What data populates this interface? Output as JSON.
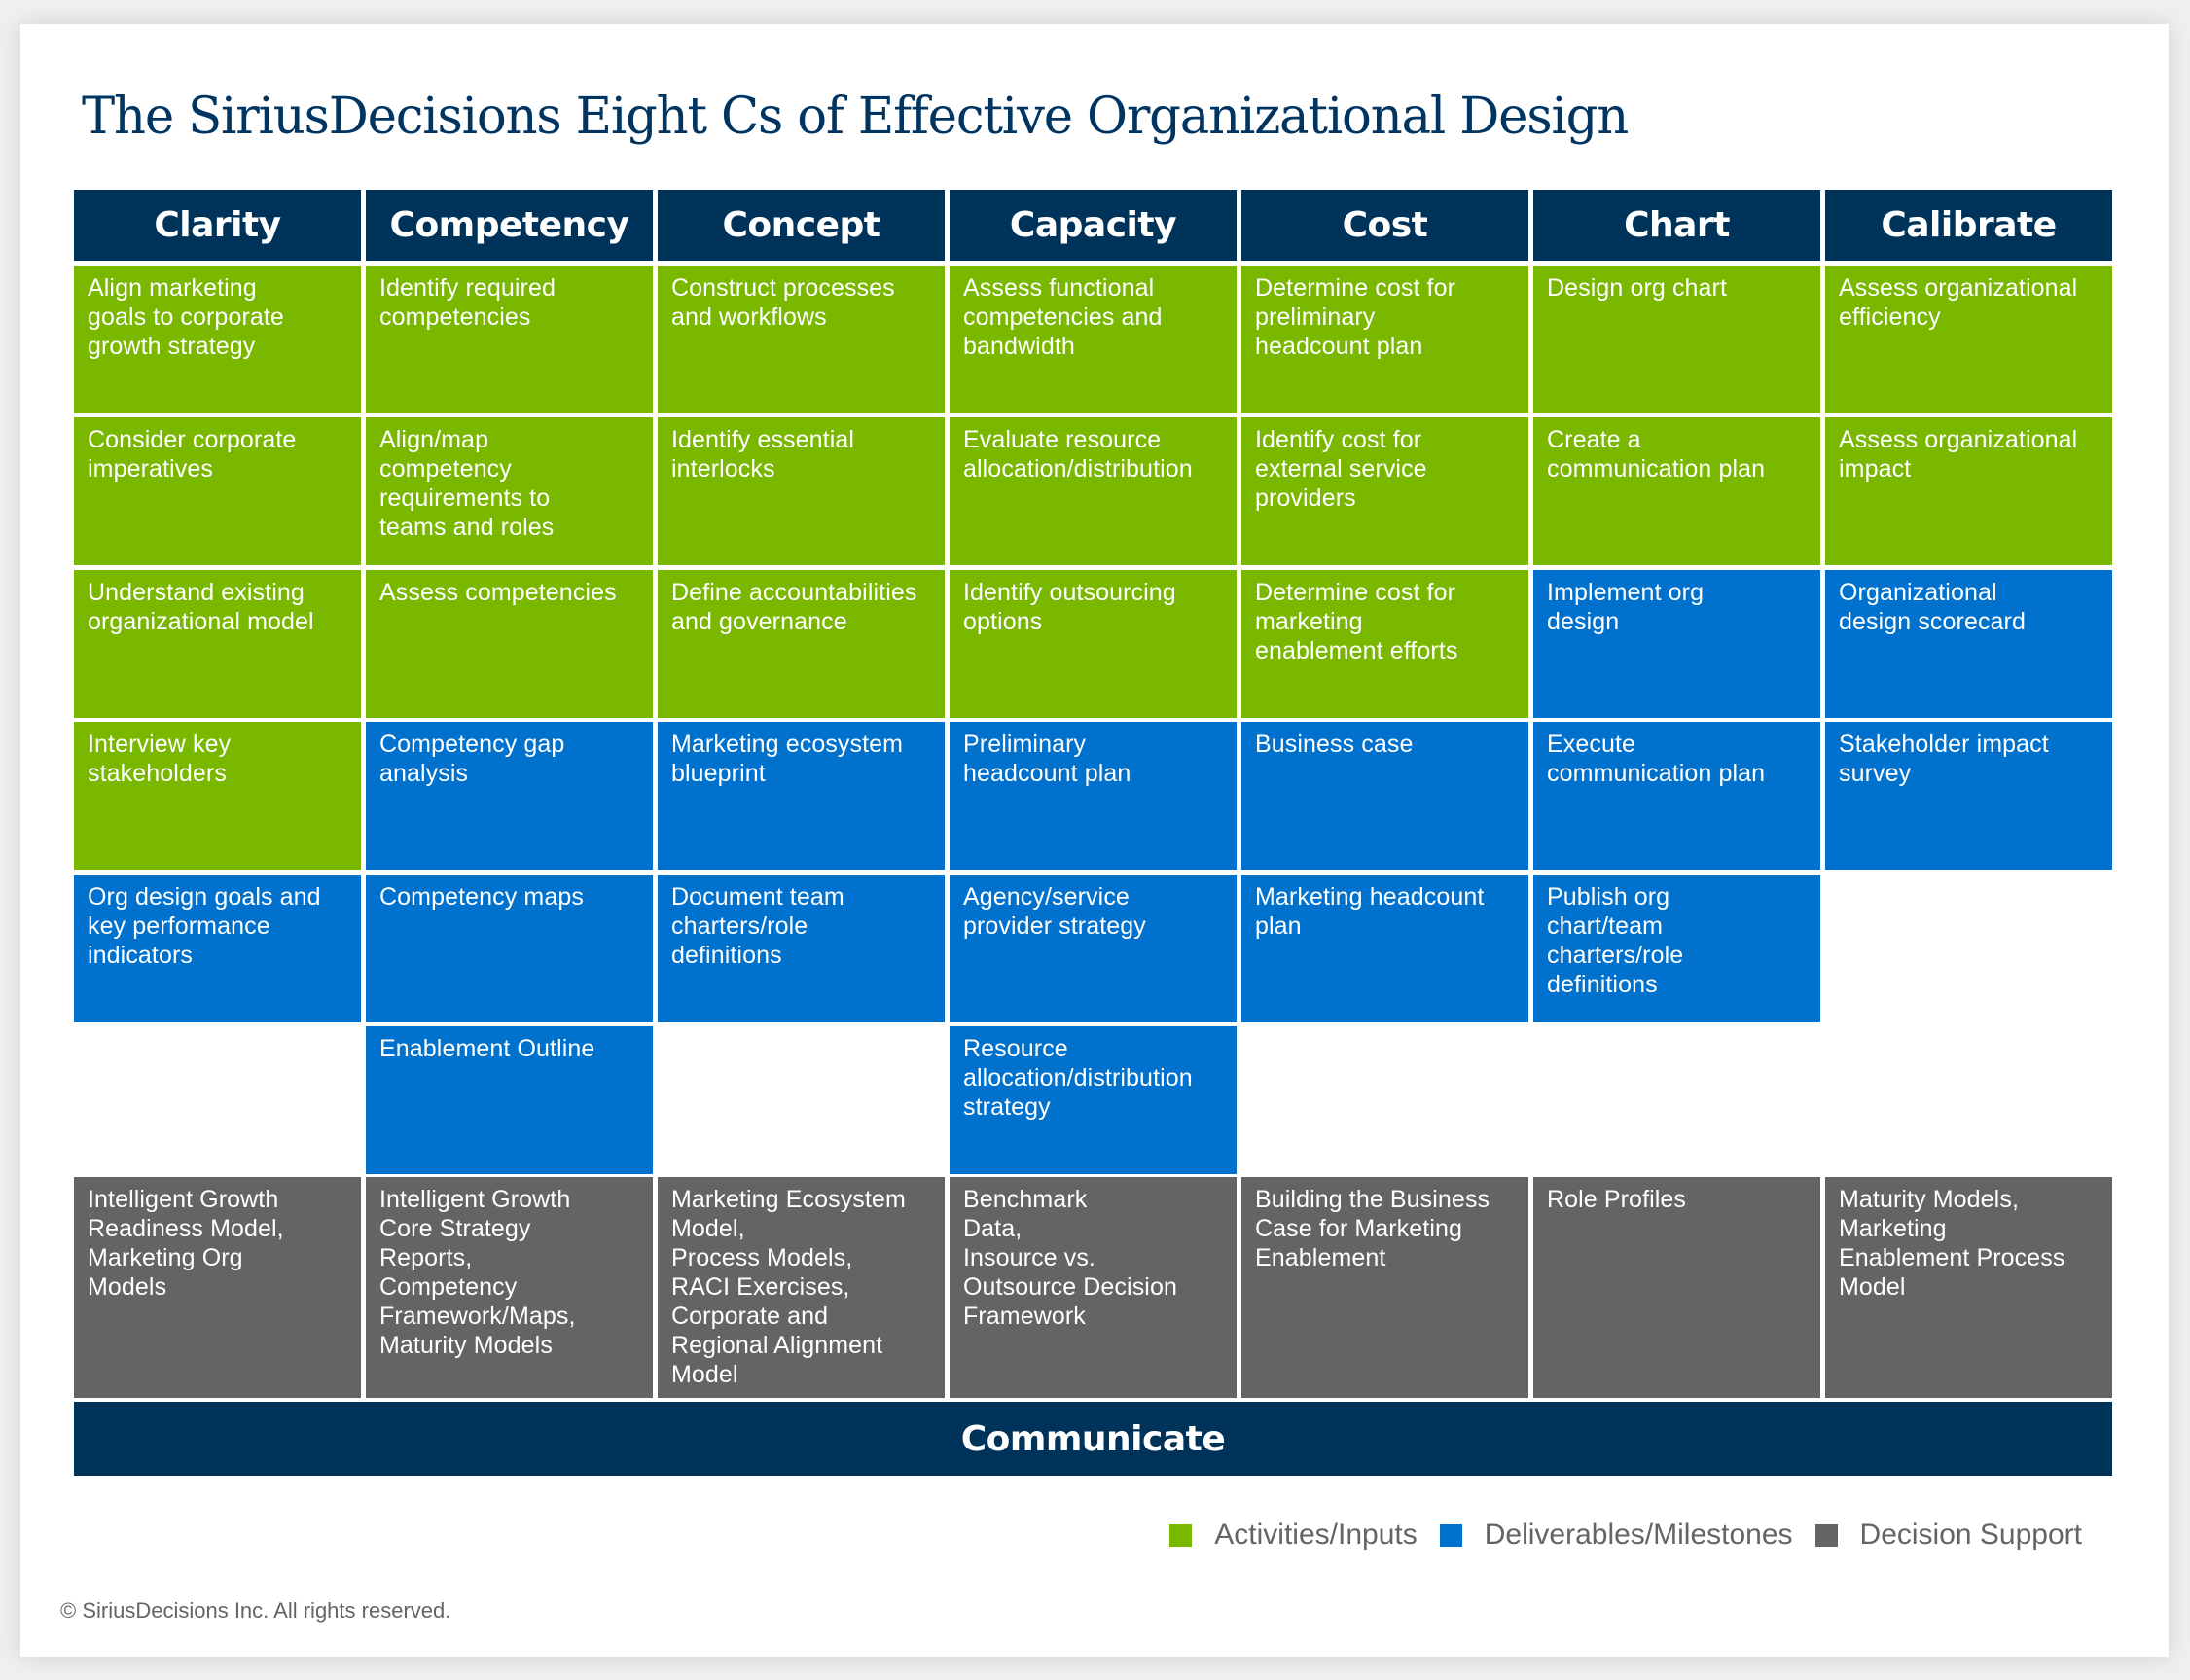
{
  "title": "The SiriusDecisions Eight Cs of Effective Organizational Design",
  "colors": {
    "header": "#003359",
    "activities": "#7ab800",
    "deliverables": "#0072ce",
    "decision_support": "#636466",
    "title": "#003461"
  },
  "columns": [
    {
      "header": "Clarity",
      "cells": [
        {
          "type": "activity",
          "text": "Align marketing\ngoals to corporate\ngrowth strategy"
        },
        {
          "type": "activity",
          "text": "Consider corporate\nimperatives"
        },
        {
          "type": "activity",
          "text": "Understand existing\norganizational model"
        },
        {
          "type": "activity",
          "text": "Interview key\nstakeholders"
        },
        {
          "type": "deliverable",
          "text": "Org design goals and\nkey performance\nindicators"
        },
        null
      ],
      "decision_support": "Intelligent Growth\nReadiness Model,\nMarketing Org\nModels"
    },
    {
      "header": "Competency",
      "cells": [
        {
          "type": "activity",
          "text": "Identify required\ncompetencies"
        },
        {
          "type": "activity",
          "text": "Align/map\ncompetency\nrequirements to\nteams and roles"
        },
        {
          "type": "activity",
          "text": "Assess competencies"
        },
        {
          "type": "deliverable",
          "text": "Competency gap\nanalysis"
        },
        {
          "type": "deliverable",
          "text": "Competency maps"
        },
        {
          "type": "deliverable",
          "text": "Enablement Outline"
        }
      ],
      "decision_support": "Intelligent Growth\nCore Strategy\nReports,\nCompetency\nFramework/Maps,\nMaturity Models"
    },
    {
      "header": "Concept",
      "cells": [
        {
          "type": "activity",
          "text": "Construct processes\nand workflows"
        },
        {
          "type": "activity",
          "text": "Identify essential\ninterlocks"
        },
        {
          "type": "activity",
          "text": "Define accountabilities\nand governance"
        },
        {
          "type": "deliverable",
          "text": "Marketing ecosystem\nblueprint"
        },
        {
          "type": "deliverable",
          "text": "Document team\ncharters/role\ndefinitions"
        },
        null
      ],
      "decision_support": "Marketing Ecosystem\nModel,\nProcess Models,\nRACI Exercises,\nCorporate and\nRegional Alignment\nModel"
    },
    {
      "header": "Capacity",
      "cells": [
        {
          "type": "activity",
          "text": "Assess functional\ncompetencies and\nbandwidth"
        },
        {
          "type": "activity",
          "text": "Evaluate resource\nallocation/distribution"
        },
        {
          "type": "activity",
          "text": "Identify outsourcing\noptions"
        },
        {
          "type": "deliverable",
          "text": "Preliminary\nheadcount plan"
        },
        {
          "type": "deliverable",
          "text": "Agency/service\nprovider strategy"
        },
        {
          "type": "deliverable",
          "text": "Resource\nallocation/distribution\nstrategy"
        }
      ],
      "decision_support": "Benchmark\nData,\nInsource vs.\nOutsource Decision\nFramework"
    },
    {
      "header": "Cost",
      "cells": [
        {
          "type": "activity",
          "text": "Determine cost for\npreliminary\nheadcount plan"
        },
        {
          "type": "activity",
          "text": "Identify cost for\nexternal service\nproviders"
        },
        {
          "type": "activity",
          "text": "Determine cost for\nmarketing\nenablement efforts"
        },
        {
          "type": "deliverable",
          "text": "Business case"
        },
        {
          "type": "deliverable",
          "text": "Marketing headcount\nplan"
        },
        null
      ],
      "decision_support": "Building the Business\nCase for Marketing\nEnablement"
    },
    {
      "header": "Chart",
      "cells": [
        {
          "type": "activity",
          "text": "Design org chart"
        },
        {
          "type": "activity",
          "text": "Create a\ncommunication plan"
        },
        {
          "type": "deliverable",
          "text": "Implement org\ndesign"
        },
        {
          "type": "deliverable",
          "text": "Execute\ncommunication plan"
        },
        {
          "type": "deliverable",
          "text": "Publish org\nchart/team\ncharters/role\ndefinitions"
        },
        null
      ],
      "decision_support": "Role Profiles"
    },
    {
      "header": "Calibrate",
      "cells": [
        {
          "type": "activity",
          "text": "Assess organizational\nefficiency"
        },
        {
          "type": "activity",
          "text": "Assess organizational\nimpact"
        },
        {
          "type": "deliverable",
          "text": "Organizational\ndesign scorecard"
        },
        {
          "type": "deliverable",
          "text": "Stakeholder impact\nsurvey"
        },
        null,
        null
      ],
      "decision_support": "Maturity Models,\nMarketing\nEnablement Process\nModel"
    }
  ],
  "footer_bar": "Communicate",
  "legend": [
    {
      "key": "activity",
      "label": "Activities/Inputs"
    },
    {
      "key": "deliverable",
      "label": "Deliverables/Milestones"
    },
    {
      "key": "decision",
      "label": "Decision Support"
    }
  ],
  "copyright": "© SiriusDecisions Inc. All rights reserved."
}
